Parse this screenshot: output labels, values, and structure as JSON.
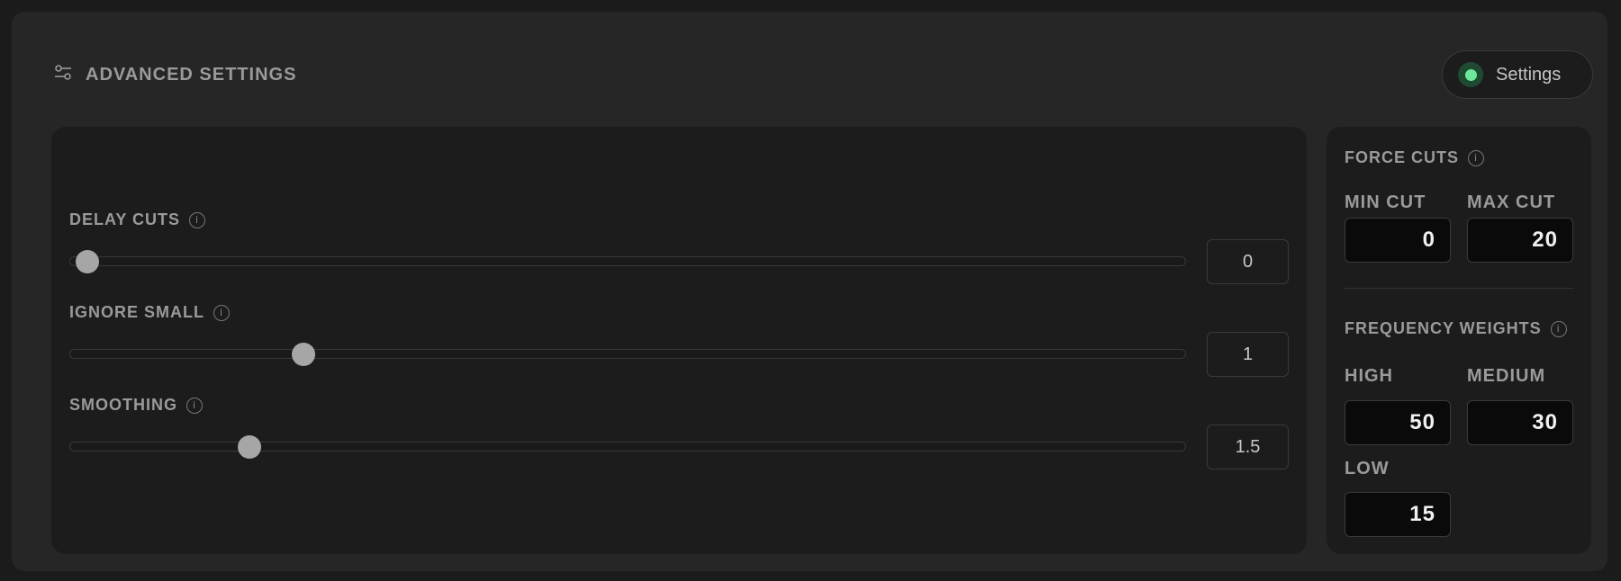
{
  "header": {
    "title": "ADVANCED SETTINGS",
    "icon": "sliders-icon",
    "settings_button": {
      "label": "Settings",
      "status_color": "#6ee79a"
    }
  },
  "sliders": [
    {
      "label": "DELAY CUTS",
      "value": "0",
      "fraction": 0.015
    },
    {
      "label": "IGNORE SMALL",
      "value": "1",
      "fraction": 0.209
    },
    {
      "label": "SMOOTHING",
      "value": "1.5",
      "fraction": 0.161
    }
  ],
  "force_cuts": {
    "title": "FORCE CUTS",
    "min": {
      "label": "MIN CUT",
      "value": "0"
    },
    "max": {
      "label": "MAX CUT",
      "value": "20"
    }
  },
  "frequency_weights": {
    "title": "FREQUENCY WEIGHTS",
    "high": {
      "label": "HIGH",
      "value": "50"
    },
    "medium": {
      "label": "MEDIUM",
      "value": "30"
    },
    "low": {
      "label": "LOW",
      "value": "15"
    }
  }
}
